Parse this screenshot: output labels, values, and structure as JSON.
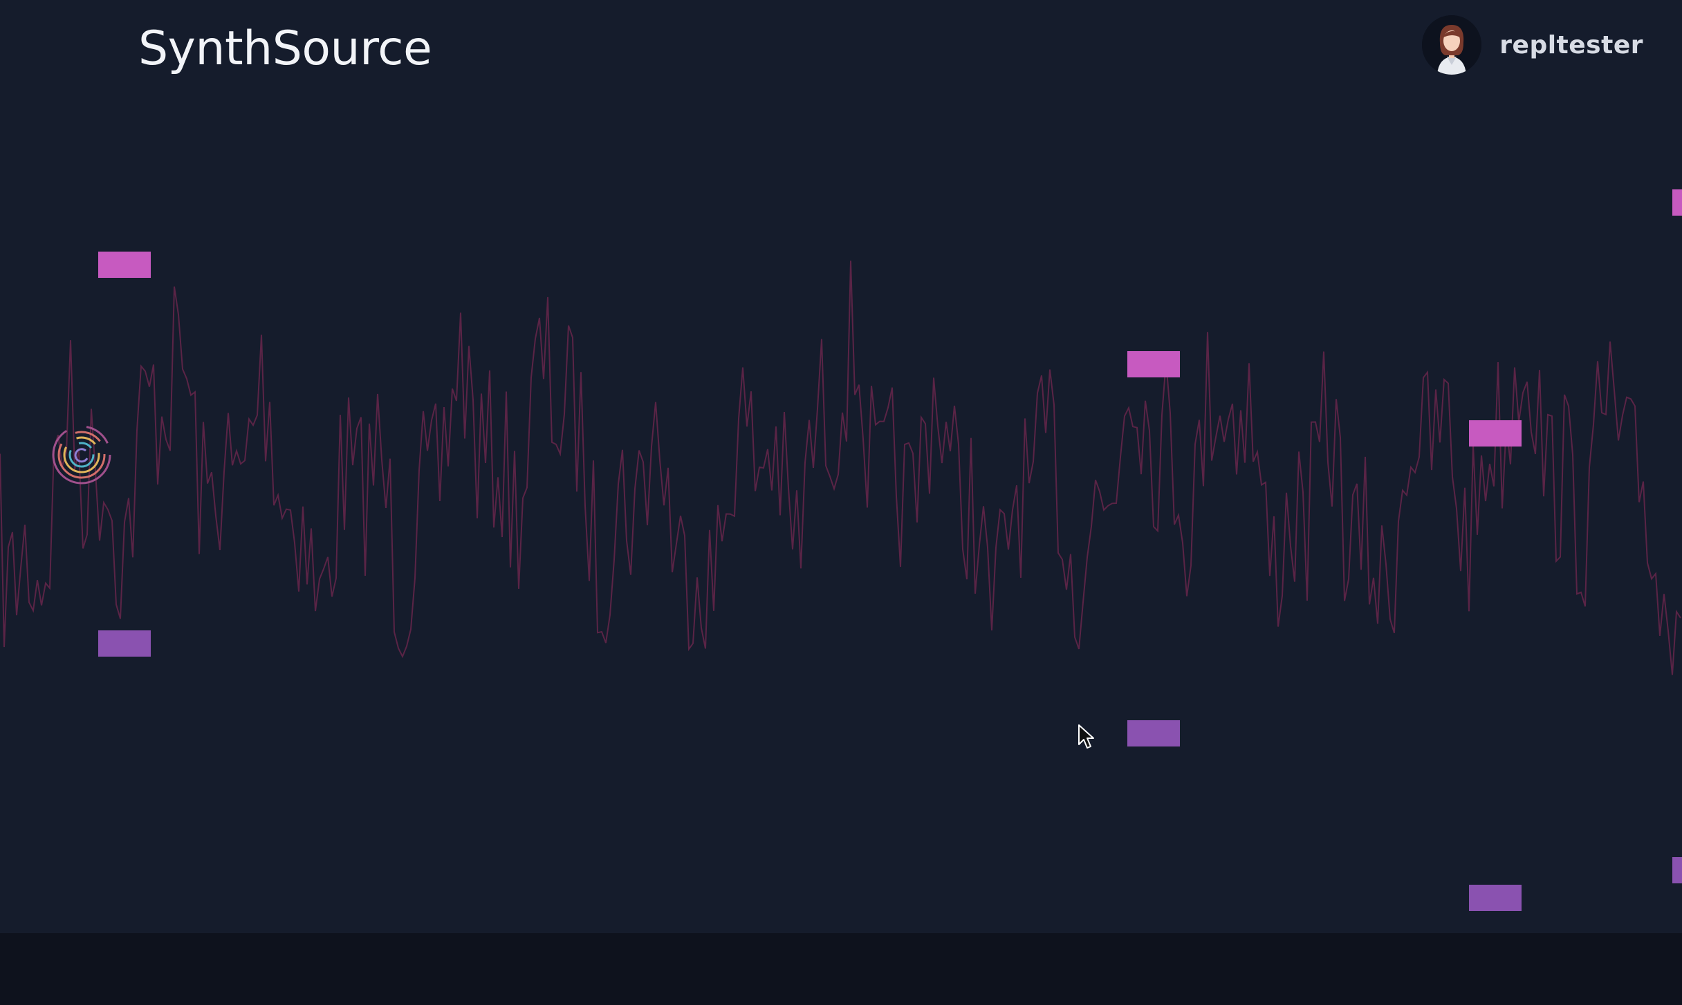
{
  "app": {
    "title": "SynthSource"
  },
  "user": {
    "name": "repltester",
    "avatar_icon": "user-avatar-icon"
  },
  "colors": {
    "background": "#151c2c",
    "footer": "#0e121d",
    "waveform": "#5a2446",
    "note_high": "#c75ac0",
    "note_low": "#8a52b0"
  },
  "player": {
    "icon": "spiral-player-icon"
  }
}
